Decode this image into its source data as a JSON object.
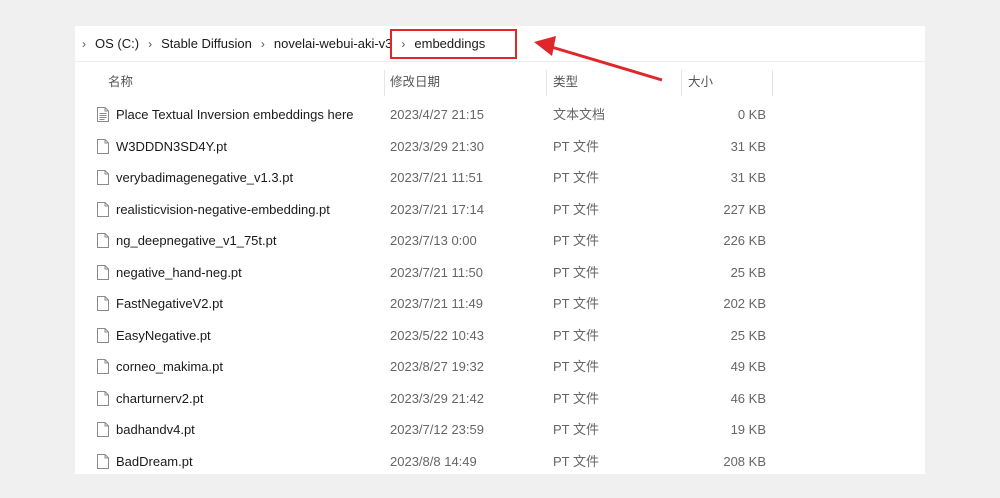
{
  "breadcrumb": {
    "items": [
      "OS (C:)",
      "Stable Diffusion",
      "novelai-webui-aki-v3",
      "embeddings"
    ]
  },
  "columns": {
    "name": "名称",
    "modified": "修改日期",
    "type": "类型",
    "size": "大小"
  },
  "files": [
    {
      "name": "Place Textual Inversion embeddings here",
      "modified": "2023/4/27 21:15",
      "type": "文本文档",
      "size": "0 KB",
      "icon": "text-file-icon"
    },
    {
      "name": "W3DDDN3SD4Y.pt",
      "modified": "2023/3/29 21:30",
      "type": "PT 文件",
      "size": "31 KB",
      "icon": "file-icon"
    },
    {
      "name": "verybadimagenegative_v1.3.pt",
      "modified": "2023/7/21 11:51",
      "type": "PT 文件",
      "size": "31 KB",
      "icon": "file-icon"
    },
    {
      "name": "realisticvision-negative-embedding.pt",
      "modified": "2023/7/21 17:14",
      "type": "PT 文件",
      "size": "227 KB",
      "icon": "file-icon"
    },
    {
      "name": "ng_deepnegative_v1_75t.pt",
      "modified": "2023/7/13 0:00",
      "type": "PT 文件",
      "size": "226 KB",
      "icon": "file-icon"
    },
    {
      "name": "negative_hand-neg.pt",
      "modified": "2023/7/21 11:50",
      "type": "PT 文件",
      "size": "25 KB",
      "icon": "file-icon"
    },
    {
      "name": "FastNegativeV2.pt",
      "modified": "2023/7/21 11:49",
      "type": "PT 文件",
      "size": "202 KB",
      "icon": "file-icon"
    },
    {
      "name": "EasyNegative.pt",
      "modified": "2023/5/22 10:43",
      "type": "PT 文件",
      "size": "25 KB",
      "icon": "file-icon"
    },
    {
      "name": "corneo_makima.pt",
      "modified": "2023/8/27 19:32",
      "type": "PT 文件",
      "size": "49 KB",
      "icon": "file-icon"
    },
    {
      "name": "charturnerv2.pt",
      "modified": "2023/3/29 21:42",
      "type": "PT 文件",
      "size": "46 KB",
      "icon": "file-icon"
    },
    {
      "name": "badhandv4.pt",
      "modified": "2023/7/12 23:59",
      "type": "PT 文件",
      "size": "19 KB",
      "icon": "file-icon"
    },
    {
      "name": "BadDream.pt",
      "modified": "2023/8/8 14:49",
      "type": "PT 文件",
      "size": "208 KB",
      "icon": "file-icon"
    }
  ],
  "annotation": {
    "color": "#e0262b"
  }
}
